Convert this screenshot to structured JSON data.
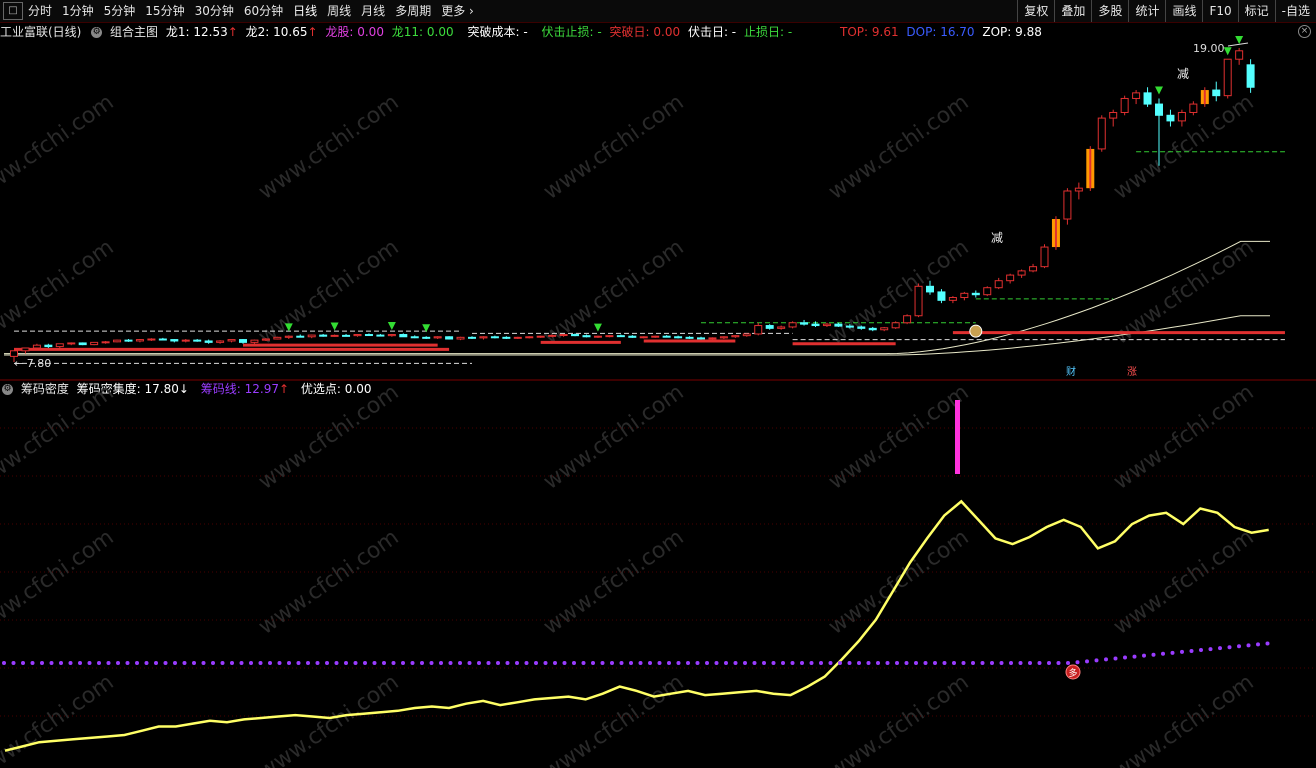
{
  "toolbar": {
    "menu_icon": "menu-icon",
    "periods": [
      "分时",
      "1分钟",
      "5分钟",
      "15分钟",
      "30分钟",
      "60分钟",
      "日线",
      "周线",
      "月线",
      "多周期",
      "更多"
    ],
    "right_buttons": [
      "复权",
      "叠加",
      "多股",
      "统计",
      "画线",
      "F10",
      "标记",
      "-自选"
    ]
  },
  "main_header": {
    "stock": "工业富联(日线)",
    "indicator": "组合主图",
    "long1": "龙1: 12.53",
    "long2": "龙2: 10.65",
    "longgu": "龙股: 0.00",
    "long11": "龙11: 0.00",
    "breakout_cost": "突破成本: -",
    "ambush_stop": "伏击止损: -",
    "breakout_day": "突破日: 0.00",
    "ambush_day": "伏击日: -",
    "stop_day": "止损日: -",
    "top": "TOP: 9.61",
    "dop": "DOP: 16.70",
    "zop": "ZOP: 9.88"
  },
  "price_label_high": "19.00",
  "price_label_low": "7.80",
  "marks": {
    "reduce": "减",
    "cai": "财",
    "zhang": "涨",
    "duo": "多"
  },
  "sub_header": {
    "name": "筹码密度",
    "concentration": "筹码密集度: 17.80",
    "chip_line": "筹码线: 12.97",
    "pick_point": "优选点: 0.00"
  },
  "watermark": "www.cfchi.com",
  "colors": {
    "up": "#e03030",
    "down": "#54ffff",
    "yellow": "#ffff66",
    "purple": "#9a3cff",
    "magenta": "#ff33dd",
    "green": "#33dd33",
    "orange": "#ff9a00"
  },
  "chart_data": [
    {
      "type": "candlestick",
      "title": "工业富联(日线)",
      "ylim": [
        7.8,
        19.0
      ],
      "bars": [
        [
          8.0,
          8.2,
          7.8,
          8.2
        ],
        [
          8.2,
          8.3,
          8.1,
          8.3
        ],
        [
          8.3,
          8.45,
          8.25,
          8.4
        ],
        [
          8.4,
          8.45,
          8.3,
          8.35
        ],
        [
          8.35,
          8.45,
          8.3,
          8.45
        ],
        [
          8.45,
          8.5,
          8.4,
          8.48
        ],
        [
          8.48,
          8.5,
          8.4,
          8.42
        ],
        [
          8.42,
          8.5,
          8.4,
          8.5
        ],
        [
          8.5,
          8.55,
          8.45,
          8.52
        ],
        [
          8.52,
          8.6,
          8.5,
          8.58
        ],
        [
          8.58,
          8.62,
          8.52,
          8.55
        ],
        [
          8.55,
          8.62,
          8.5,
          8.6
        ],
        [
          8.6,
          8.65,
          8.55,
          8.62
        ],
        [
          8.62,
          8.66,
          8.58,
          8.6
        ],
        [
          8.6,
          8.62,
          8.5,
          8.55
        ],
        [
          8.55,
          8.62,
          8.5,
          8.58
        ],
        [
          8.58,
          8.62,
          8.52,
          8.55
        ],
        [
          8.55,
          8.6,
          8.45,
          8.5
        ],
        [
          8.5,
          8.58,
          8.45,
          8.55
        ],
        [
          8.55,
          8.6,
          8.5,
          8.6
        ],
        [
          8.6,
          8.62,
          8.45,
          8.5
        ],
        [
          8.5,
          8.6,
          8.45,
          8.58
        ],
        [
          8.58,
          8.65,
          8.55,
          8.62
        ],
        [
          8.62,
          8.7,
          8.6,
          8.68
        ],
        [
          8.68,
          8.75,
          8.62,
          8.72
        ],
        [
          8.72,
          8.78,
          8.68,
          8.7
        ],
        [
          8.7,
          8.78,
          8.65,
          8.76
        ],
        [
          8.76,
          8.8,
          8.7,
          8.72
        ],
        [
          8.72,
          8.78,
          8.7,
          8.75
        ],
        [
          8.75,
          8.8,
          8.72,
          8.74
        ],
        [
          8.74,
          8.8,
          8.7,
          8.78
        ],
        [
          8.78,
          8.82,
          8.74,
          8.76
        ],
        [
          8.76,
          8.8,
          8.72,
          8.74
        ],
        [
          8.74,
          8.8,
          8.7,
          8.78
        ],
        [
          8.78,
          8.82,
          8.72,
          8.7
        ],
        [
          8.7,
          8.75,
          8.65,
          8.68
        ],
        [
          8.68,
          8.72,
          8.62,
          8.66
        ],
        [
          8.66,
          8.72,
          8.62,
          8.7
        ],
        [
          8.7,
          8.72,
          8.6,
          8.62
        ],
        [
          8.62,
          8.7,
          8.58,
          8.68
        ],
        [
          8.68,
          8.72,
          8.62,
          8.66
        ],
        [
          8.66,
          8.72,
          8.6,
          8.7
        ],
        [
          8.7,
          8.74,
          8.64,
          8.68
        ],
        [
          8.68,
          8.72,
          8.62,
          8.66
        ],
        [
          8.66,
          8.7,
          8.62,
          8.68
        ],
        [
          8.68,
          8.72,
          8.64,
          8.7
        ],
        [
          8.7,
          8.74,
          8.66,
          8.72
        ],
        [
          8.72,
          8.78,
          8.68,
          8.75
        ],
        [
          8.75,
          8.8,
          8.7,
          8.78
        ],
        [
          8.78,
          8.82,
          8.72,
          8.74
        ],
        [
          8.74,
          8.78,
          8.68,
          8.7
        ],
        [
          8.7,
          8.74,
          8.66,
          8.72
        ],
        [
          8.72,
          8.76,
          8.68,
          8.74
        ],
        [
          8.74,
          8.78,
          8.7,
          8.72
        ],
        [
          8.72,
          8.76,
          8.66,
          8.68
        ],
        [
          8.68,
          8.72,
          8.64,
          8.7
        ],
        [
          8.7,
          8.74,
          8.66,
          8.72
        ],
        [
          8.72,
          8.76,
          8.68,
          8.7
        ],
        [
          8.7,
          8.74,
          8.64,
          8.68
        ],
        [
          8.68,
          8.72,
          8.62,
          8.66
        ],
        [
          8.66,
          8.7,
          8.6,
          8.64
        ],
        [
          8.64,
          8.68,
          8.6,
          8.66
        ],
        [
          8.66,
          8.72,
          8.62,
          8.7
        ],
        [
          8.7,
          8.76,
          8.66,
          8.74
        ],
        [
          8.74,
          8.82,
          8.7,
          8.8
        ],
        [
          8.8,
          9.2,
          8.75,
          9.1
        ],
        [
          9.1,
          9.15,
          8.95,
          9.0
        ],
        [
          9.0,
          9.1,
          8.95,
          9.05
        ],
        [
          9.05,
          9.25,
          9.0,
          9.2
        ],
        [
          9.2,
          9.3,
          9.1,
          9.15
        ],
        [
          9.15,
          9.25,
          9.05,
          9.1
        ],
        [
          9.1,
          9.2,
          9.05,
          9.15
        ],
        [
          9.15,
          9.2,
          9.05,
          9.08
        ],
        [
          9.08,
          9.15,
          9.0,
          9.05
        ],
        [
          9.05,
          9.1,
          8.95,
          9.0
        ],
        [
          9.0,
          9.05,
          8.9,
          8.95
        ],
        [
          8.95,
          9.05,
          8.9,
          9.02
        ],
        [
          9.02,
          9.25,
          8.98,
          9.2
        ],
        [
          9.2,
          9.5,
          9.15,
          9.45
        ],
        [
          9.45,
          10.6,
          9.4,
          10.5
        ],
        [
          10.5,
          10.7,
          10.2,
          10.3
        ],
        [
          10.3,
          10.4,
          9.9,
          10.0
        ],
        [
          10.0,
          10.15,
          9.9,
          10.1
        ],
        [
          10.1,
          10.3,
          10.0,
          10.25
        ],
        [
          10.25,
          10.35,
          10.1,
          10.2
        ],
        [
          10.2,
          10.5,
          10.15,
          10.45
        ],
        [
          10.45,
          10.8,
          10.4,
          10.7
        ],
        [
          10.7,
          10.95,
          10.6,
          10.9
        ],
        [
          10.9,
          11.1,
          10.8,
          11.05
        ],
        [
          11.05,
          11.3,
          11.0,
          11.2
        ],
        [
          11.2,
          12.0,
          11.15,
          11.9
        ],
        [
          11.9,
          13.0,
          11.8,
          12.9
        ],
        [
          12.9,
          14.0,
          12.7,
          13.9
        ],
        [
          13.9,
          14.2,
          13.6,
          14.0
        ],
        [
          14.0,
          15.5,
          13.9,
          15.4
        ],
        [
          15.4,
          16.6,
          15.3,
          16.5
        ],
        [
          16.5,
          16.8,
          16.2,
          16.7
        ],
        [
          16.7,
          17.3,
          16.6,
          17.2
        ],
        [
          17.2,
          17.5,
          17.0,
          17.4
        ],
        [
          17.4,
          17.6,
          16.9,
          17.0
        ],
        [
          17.0,
          17.2,
          14.8,
          16.6
        ],
        [
          16.6,
          16.8,
          16.2,
          16.4
        ],
        [
          16.4,
          16.8,
          16.2,
          16.7
        ],
        [
          16.7,
          17.1,
          16.6,
          17.0
        ],
        [
          17.0,
          17.6,
          16.9,
          17.5
        ],
        [
          17.5,
          17.8,
          17.1,
          17.3
        ],
        [
          17.3,
          18.6,
          17.2,
          18.6
        ],
        [
          18.6,
          19.0,
          18.4,
          18.9
        ],
        [
          18.4,
          18.6,
          17.4,
          17.6
        ]
      ],
      "ma_upper": [
        8.1,
        12.1
      ],
      "ma_lower": [
        8.05,
        9.45
      ]
    },
    {
      "type": "line",
      "title": "筹码密度",
      "series": [
        {
          "name": "筹码密集度",
          "values": [
            0.3,
            0.6,
            0.9,
            1.0,
            1.1,
            1.2,
            1.3,
            1.4,
            1.7,
            2.0,
            2.0,
            2.2,
            2.4,
            2.3,
            2.5,
            2.6,
            2.7,
            2.8,
            2.7,
            2.6,
            2.8,
            2.9,
            3.0,
            3.1,
            3.3,
            3.4,
            3.3,
            3.6,
            3.8,
            3.5,
            3.7,
            3.9,
            4.0,
            4.1,
            3.9,
            4.3,
            4.8,
            4.5,
            4.1,
            4.3,
            4.5,
            4.2,
            4.3,
            4.4,
            4.5,
            4.3,
            4.2,
            4.8,
            5.5,
            6.7,
            8.0,
            9.5,
            11.5,
            13.5,
            15.2,
            16.8,
            17.8,
            16.5,
            15.2,
            14.8,
            15.3,
            16.0,
            16.5,
            16.0,
            14.5,
            15.0,
            16.2,
            16.8,
            17.0,
            16.2,
            17.3,
            17.0,
            16.0,
            15.6,
            15.8
          ]
        },
        {
          "name": "筹码线",
          "values": [
            0.0,
            12.97
          ]
        }
      ]
    }
  ]
}
